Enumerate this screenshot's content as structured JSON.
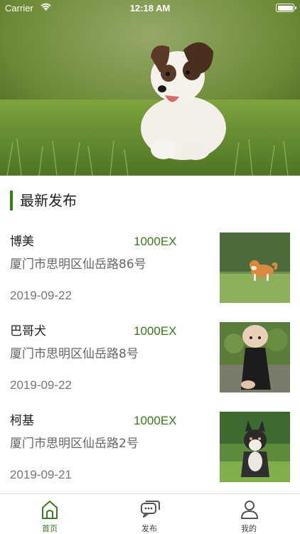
{
  "status_bar": {
    "carrier": "Carrier",
    "time": "12:18 AM"
  },
  "section": {
    "title": "最新发布"
  },
  "items": [
    {
      "name": "博美",
      "price": "1000EX",
      "address": "厦门市思明区仙岳路86号",
      "date": "2019-09-22"
    },
    {
      "name": "巴哥犬",
      "price": "1000EX",
      "address": "厦门市思明区仙岳路8号",
      "date": "2019-09-22"
    },
    {
      "name": "柯基",
      "price": "1000EX",
      "address": "厦门市思明区仙岳路2号",
      "date": "2019-09-21"
    }
  ],
  "tabs": [
    {
      "label": "首页",
      "icon": "home-icon",
      "active": true
    },
    {
      "label": "发布",
      "icon": "chat-icon",
      "active": false
    },
    {
      "label": "我的",
      "icon": "user-icon",
      "active": false
    }
  ],
  "colors": {
    "accent": "#3c7a22",
    "price": "#3a7a1e"
  }
}
